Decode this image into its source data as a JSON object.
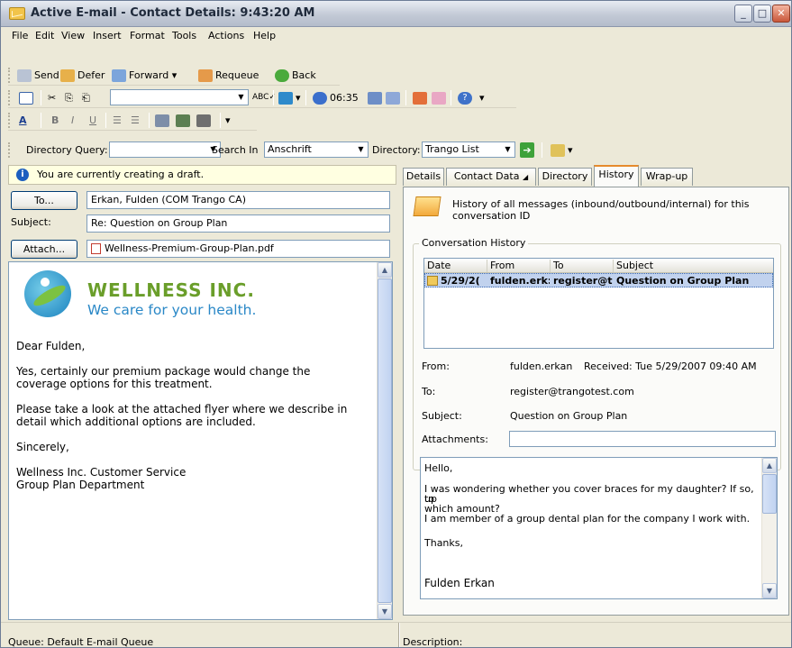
{
  "window": {
    "title": "Active E-mail - Contact Details: 9:43:20 AM"
  },
  "menu": [
    "File",
    "Edit",
    "View",
    "Insert",
    "Format",
    "Tools",
    "Actions",
    "Help"
  ],
  "actions_toolbar": {
    "send": "Send",
    "defer": "Defer",
    "forward": "Forward",
    "requeue": "Requeue",
    "back": "Back"
  },
  "format_toolbar": {
    "timer": "06:35",
    "spell": "ABC"
  },
  "directory_bar": {
    "query_label": "Directory Query:",
    "query_value": "",
    "search_in_label": "Search In",
    "search_in_value": "Anschrift",
    "directory_label": "Directory:",
    "directory_value": "Trango List"
  },
  "draft_notice": "You are currently creating a draft.",
  "compose": {
    "to_button": "To...",
    "to_value": "Erkan, Fulden  (COM Trango CA)",
    "subject_label": "Subject:",
    "subject_value": "Re: Question on Group Plan",
    "attach_button": "Attach...",
    "attachment": "Wellness-Premium-Group-Plan.pdf",
    "logo": {
      "name": "WELLNESS INC.",
      "tagline": "We care for your health."
    },
    "body": [
      "Dear Fulden,",
      "Yes, certainly our premium package would change the",
      "coverage options for this treatment.",
      "Please take a look at the attached flyer where we describe in",
      "detail which additional options are included.",
      "Sincerely,",
      "Wellness Inc. Customer Service",
      "Group Plan Department"
    ]
  },
  "tabs": [
    {
      "label": "Details",
      "active": false
    },
    {
      "label": "Contact Data",
      "active": false
    },
    {
      "label": "Directory",
      "active": false
    },
    {
      "label": "History",
      "active": true
    },
    {
      "label": "Wrap-up",
      "active": false
    }
  ],
  "history": {
    "description": "History of all messages (inbound/outbound/internal) for this conversation ID",
    "group_title": "Conversation History",
    "columns": [
      "Date",
      "From",
      "To",
      "Subject"
    ],
    "rows": [
      {
        "date": "5/29/2(",
        "from": "fulden.erk:",
        "to": "register@t",
        "subject": "Question on Group Plan"
      }
    ],
    "details": {
      "from_label": "From:",
      "from_value": "fulden.erkan",
      "received": "Received: Tue 5/29/2007 09:40 AM",
      "to_label": "To:",
      "to_value": "register@trangotest.com",
      "subject_label": "Subject:",
      "subject_value": "Question on Group Plan",
      "attachments_label": "Attachments:",
      "attachments_value": ""
    },
    "message": [
      "Hello,",
      "I was wondering whether you cover braces for my daughter? If so, up",
      "to",
      "which amount?",
      "I am member of a group dental plan for the company I work with.",
      "Thanks,",
      "Fulden Erkan"
    ]
  },
  "status": {
    "left": "Queue: Default E-mail Queue",
    "right": "Description:"
  }
}
